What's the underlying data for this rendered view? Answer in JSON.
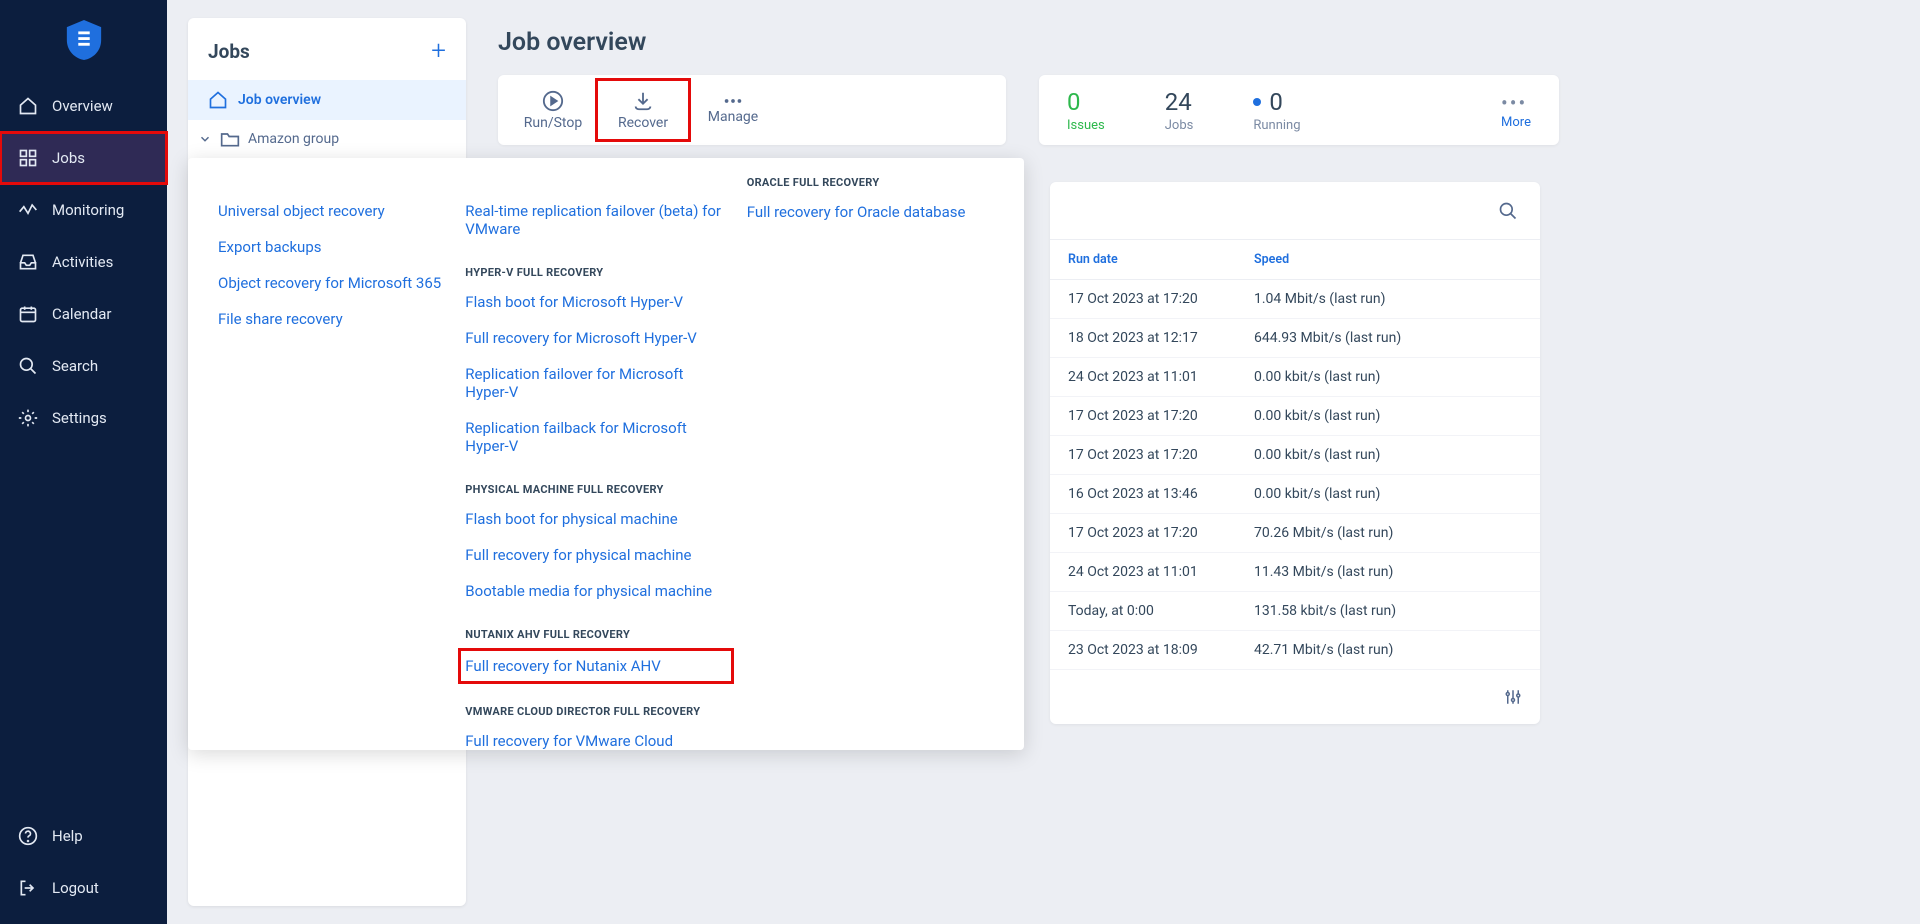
{
  "sidebar": {
    "items": [
      {
        "label": "Overview"
      },
      {
        "label": "Jobs"
      },
      {
        "label": "Monitoring"
      },
      {
        "label": "Activities"
      },
      {
        "label": "Calendar"
      },
      {
        "label": "Search"
      },
      {
        "label": "Settings"
      }
    ],
    "footer": [
      {
        "label": "Help"
      },
      {
        "label": "Logout"
      }
    ]
  },
  "jobs_panel": {
    "title": "Jobs",
    "overview_label": "Job overview",
    "tree": [
      {
        "label": "Amazon group"
      }
    ]
  },
  "page": {
    "title": "Job overview"
  },
  "toolbar": {
    "run_stop": "Run/Stop",
    "recover": "Recover",
    "manage": "Manage"
  },
  "stats": {
    "issues_value": "0",
    "issues_label": "Issues",
    "jobs_value": "24",
    "jobs_label": "Jobs",
    "running_value": "0",
    "running_label": "Running",
    "more_label": "More"
  },
  "dropdown": {
    "col1": {
      "links_top": [
        "Universal object recovery",
        "Export backups",
        "Object recovery for Microsoft 365",
        "File share recovery"
      ]
    },
    "col2": {
      "link_rt": "Real-time replication failover (beta) for VMware",
      "h_hyperv": "HYPER-V FULL RECOVERY",
      "hyperv_links": [
        "Flash boot for Microsoft Hyper-V",
        "Full recovery for Microsoft Hyper-V",
        "Replication failover for Microsoft Hyper-V",
        "Replication failback for Microsoft Hyper-V"
      ],
      "h_physical": "PHYSICAL MACHINE FULL RECOVERY",
      "physical_links": [
        "Flash boot for physical machine",
        "Full recovery for physical machine",
        "Bootable media for physical machine"
      ],
      "h_nutanix": "NUTANIX AHV FULL RECOVERY",
      "nutanix_link": "Full recovery for Nutanix AHV",
      "h_vcd": "VMWARE CLOUD DIRECTOR FULL RECOVERY",
      "vcd_link": "Full recovery for VMware Cloud Director"
    },
    "col3": {
      "h_oracle": "ORACLE FULL RECOVERY",
      "oracle_link": "Full recovery for Oracle database"
    }
  },
  "table": {
    "col_date": "Run date",
    "col_speed": "Speed",
    "rows": [
      {
        "date": "17 Oct 2023 at 17:20",
        "speed": "1.04 Mbit/s (last run)"
      },
      {
        "date": "18 Oct 2023 at 12:17",
        "speed": "644.93 Mbit/s (last run)"
      },
      {
        "date": "24 Oct 2023 at 11:01",
        "speed": "0.00 kbit/s (last run)"
      },
      {
        "date": "17 Oct 2023 at 17:20",
        "speed": "0.00 kbit/s (last run)"
      },
      {
        "date": "17 Oct 2023 at 17:20",
        "speed": "0.00 kbit/s (last run)"
      },
      {
        "date": "16 Oct 2023 at 13:46",
        "speed": "0.00 kbit/s (last run)"
      },
      {
        "date": "17 Oct 2023 at 17:20",
        "speed": "70.26 Mbit/s (last run)"
      },
      {
        "date": "24 Oct 2023 at 11:01",
        "speed": "11.43 Mbit/s (last run)"
      },
      {
        "date": "Today, at 0:00",
        "speed": "131.58 kbit/s (last run)"
      },
      {
        "date": "23 Oct 2023 at 18:09",
        "speed": "42.71 Mbit/s (last run)"
      }
    ]
  }
}
